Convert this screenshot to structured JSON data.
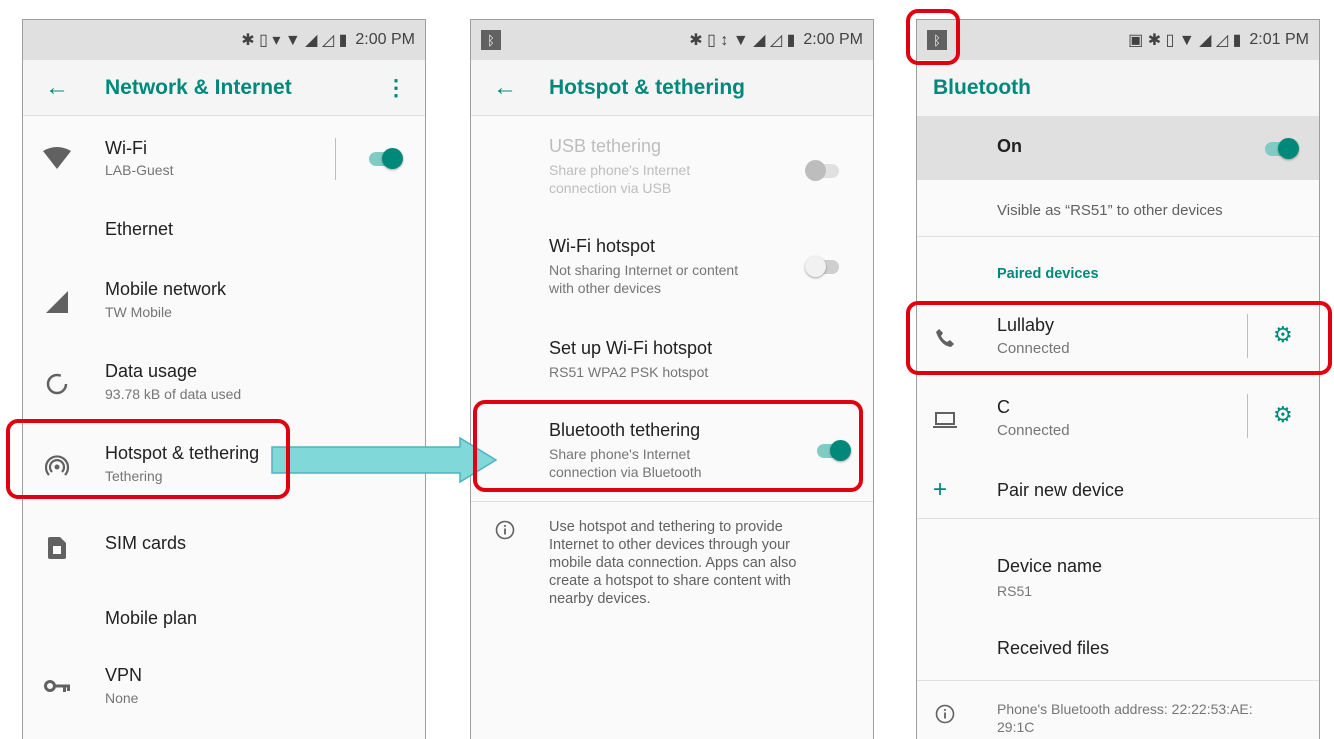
{
  "panel1": {
    "status_time": "2:00 PM",
    "title": "Network & Internet",
    "items": [
      {
        "title": "Wi-Fi",
        "subtitle": "LAB-Guest"
      },
      {
        "title": "Ethernet"
      },
      {
        "title": "Mobile network",
        "subtitle": "TW Mobile"
      },
      {
        "title": "Data usage",
        "subtitle": "93.78 kB of data used"
      },
      {
        "title": "Hotspot & tethering",
        "subtitle": "Tethering"
      },
      {
        "title": "SIM cards"
      },
      {
        "title": "Mobile plan"
      },
      {
        "title": "VPN",
        "subtitle": "None"
      }
    ]
  },
  "panel2": {
    "status_time": "2:00 PM",
    "title": "Hotspot & tethering",
    "items": [
      {
        "title": "USB tethering",
        "subtitle_l1": "Share phone's Internet",
        "subtitle_l2": "connection via USB"
      },
      {
        "title": "Wi-Fi hotspot",
        "subtitle_l1": "Not sharing Internet or content",
        "subtitle_l2": "with other devices"
      },
      {
        "title": "Set up Wi-Fi hotspot",
        "subtitle_l1": "RS51 WPA2 PSK hotspot"
      },
      {
        "title": "Bluetooth tethering",
        "subtitle_l1": "Share phone's Internet",
        "subtitle_l2": "connection via Bluetooth"
      }
    ],
    "info_lines": [
      "Use hotspot and tethering to provide",
      "Internet to other devices through your",
      "mobile data connection. Apps can also",
      "create a hotspot to share content with",
      "nearby devices."
    ]
  },
  "panel3": {
    "status_time": "2:01 PM",
    "title": "Bluetooth",
    "on_label": "On",
    "visible_text": "Visible as “RS51” to other devices",
    "paired_header": "Paired devices",
    "devices": [
      {
        "name": "Lullaby",
        "status": "Connected"
      },
      {
        "name": "C",
        "status": "Connected"
      }
    ],
    "pair_new": "Pair new device",
    "device_name_label": "Device name",
    "device_name_value": "RS51",
    "received_files": "Received files",
    "address_l1": "Phone's Bluetooth address: 22:22:53:AE:",
    "address_l2": "29:1C"
  },
  "colors": {
    "accent": "#00897b",
    "highlight": "#e0000f",
    "arrow": "#80d8d8"
  }
}
